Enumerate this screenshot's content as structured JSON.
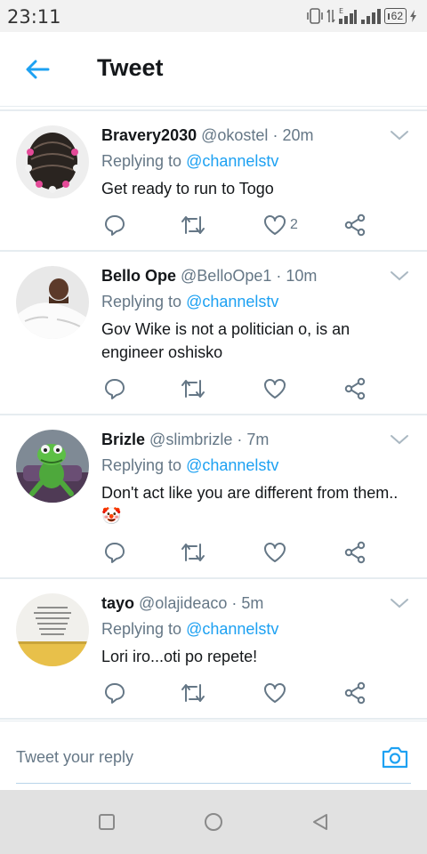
{
  "status_bar": {
    "time": "23:11",
    "battery": "62"
  },
  "header": {
    "title": "Tweet"
  },
  "replying_prefix": "Replying to",
  "tweets": [
    {
      "author": "Bravery2030",
      "handle": "@okostel",
      "separator": "·",
      "time": "20m",
      "replying_to": "@channelstv",
      "text": "Get ready to run to Togo",
      "like_count": "2"
    },
    {
      "author": "Bello Ope",
      "handle": "@BelloOpe1",
      "separator": "·",
      "time": "10m",
      "replying_to": "@channelstv",
      "text": "Gov Wike is not a politician o,  is an engineer oshisko",
      "like_count": ""
    },
    {
      "author": "Brizle",
      "handle": "@slimbrizle",
      "separator": "·",
      "time": "7m",
      "replying_to": "@channelstv",
      "text": "Don't act like you are different from them.. 🤡",
      "like_count": ""
    },
    {
      "author": "tayo",
      "handle": "@olajideaco",
      "separator": "·",
      "time": "5m",
      "replying_to": "@channelstv",
      "text": "Lori iro...oti po repete!",
      "like_count": ""
    }
  ],
  "reply_bar": {
    "placeholder": "Tweet your reply"
  },
  "colors": {
    "accent": "#1da1f2",
    "muted": "#657786",
    "divider": "#e6ecf0"
  },
  "icons": {
    "back": "arrow-left-icon",
    "reply": "reply-icon",
    "retweet": "retweet-icon",
    "like": "heart-icon",
    "share": "share-icon",
    "camera": "camera-icon"
  }
}
